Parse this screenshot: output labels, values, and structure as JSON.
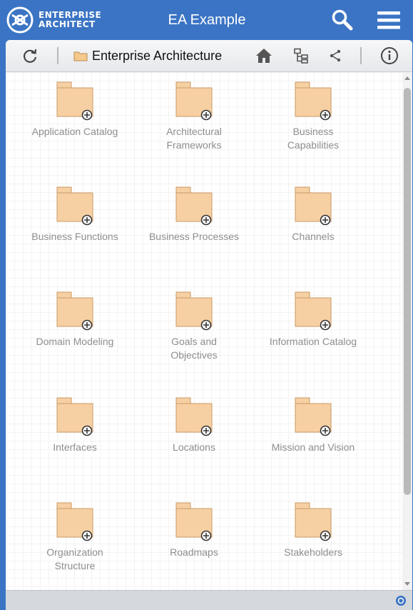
{
  "header": {
    "logo_line1": "ENTERPRISE",
    "logo_line2": "ARCHITECT",
    "title": "EA Example",
    "search_icon": "search-icon",
    "menu_icon": "hamburger-menu-icon"
  },
  "toolbar": {
    "refresh_icon": "refresh-icon",
    "breadcrumb_icon": "folder-icon",
    "breadcrumb_label": "Enterprise Architecture",
    "home_icon": "home-icon",
    "tree_icon": "tree-view-icon",
    "share_icon": "share-icon",
    "info_icon": "info-icon"
  },
  "folders": [
    {
      "label": "Application Catalog"
    },
    {
      "label": "Architectural\nFrameworks"
    },
    {
      "label": "Business\nCapabilities"
    },
    {
      "label": "Business Functions"
    },
    {
      "label": "Business Processes"
    },
    {
      "label": "Channels"
    },
    {
      "label": "Domain Modeling"
    },
    {
      "label": "Goals and\nObjectives"
    },
    {
      "label": "Information Catalog"
    },
    {
      "label": "Interfaces"
    },
    {
      "label": "Locations"
    },
    {
      "label": "Mission and Vision"
    },
    {
      "label": "Organization\nStructure"
    },
    {
      "label": "Roadmaps"
    },
    {
      "label": "Stakeholders"
    }
  ],
  "colors": {
    "header_bg": "#3b74c4",
    "folder_fill": "#f6d0a3",
    "folder_stroke": "#c99a66",
    "label_text": "#8e8e8e"
  },
  "statusbar": {
    "status_icon": "status-indicator-icon"
  }
}
